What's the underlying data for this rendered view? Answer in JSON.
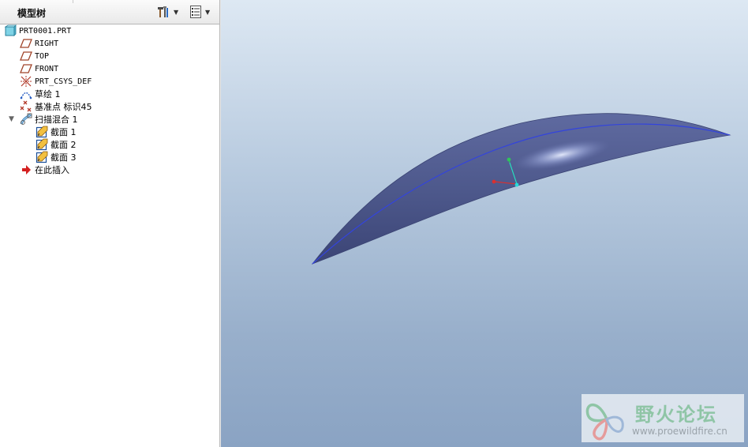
{
  "panel": {
    "title": "模型树",
    "tools_icon": "hammer-settings-icon",
    "show_icon": "tree-columns-icon"
  },
  "tree": {
    "items": [
      {
        "label": "PRT0001.PRT",
        "icon": "part-icon"
      },
      {
        "label": "RIGHT",
        "icon": "datum-plane-icon"
      },
      {
        "label": "TOP",
        "icon": "datum-plane-icon"
      },
      {
        "label": "FRONT",
        "icon": "datum-plane-icon"
      },
      {
        "label": "PRT_CSYS_DEF",
        "icon": "csys-icon"
      },
      {
        "label": "草绘 1",
        "icon": "sketch-icon"
      },
      {
        "label": "基准点 标识45",
        "icon": "datum-point-icon"
      },
      {
        "label": "扫描混合 1",
        "icon": "swept-blend-icon",
        "expanded": true
      },
      {
        "label": "截面 1",
        "icon": "section-icon"
      },
      {
        "label": "截面 2",
        "icon": "section-icon"
      },
      {
        "label": "截面 3",
        "icon": "section-icon"
      },
      {
        "label": "在此插入",
        "icon": "insert-here-arrow-icon"
      }
    ]
  },
  "viewport": {
    "surface_color": "#4f5b8e",
    "trajectory_color": "#3344dd",
    "background_top": "#dde8f3",
    "background_bottom": "#8aa3c3"
  },
  "watermark": {
    "title": "野火论坛",
    "url": "www.proewildfire.cn"
  }
}
